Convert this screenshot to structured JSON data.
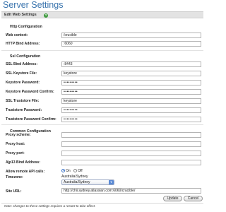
{
  "page_title": "Server Settings",
  "panel": {
    "title": "Edit Web Settings",
    "help_icon": "help-icon"
  },
  "http": {
    "title": "Http Configuration",
    "web_context_label": "Web context:",
    "web_context_value": "/crucible",
    "bind_address_label": "HTTP Bind Address:",
    "bind_address_value": ":6060"
  },
  "ssl": {
    "title": "Ssl Configuration",
    "bind_address_label": "SSL Bind Address:",
    "bind_address_value": ":8443",
    "keystore_file_label": "SSL Keystore File:",
    "keystore_file_value": "keystore",
    "keystore_password_label": "Keystore Password:",
    "keystore_password_value": "•••••••••",
    "keystore_password_confirm_label": "Keystore Password Confirm:",
    "keystore_password_confirm_value": "•••••••••",
    "truststore_file_label": "SSL Truststore File:",
    "truststore_file_value": "keystore",
    "truststore_password_label": "Truststore Password:",
    "truststore_password_value": "•••••••••",
    "truststore_password_confirm_label": "Truststore Password Confirm:",
    "truststore_password_confirm_value": "•••••••••"
  },
  "common": {
    "title": "Common Configuration",
    "proxy_scheme_label": "Proxy scheme:",
    "proxy_scheme_value": "",
    "proxy_host_label": "Proxy host:",
    "proxy_host_value": "",
    "proxy_port_label": "Proxy port:",
    "proxy_port_value": "",
    "ajp13_label": "Ajp13 Bind Address:",
    "ajp13_value": "",
    "remote_api_label": "Allow remote API calls:",
    "remote_api_on": "On",
    "remote_api_off": "Off",
    "remote_api_selected": "On",
    "timezone_label": "Timezone:",
    "timezone_text": "Australia/Sydney",
    "timezone_selected": "Australia/Sydney",
    "site_url_label": "Site URL:",
    "site_url_value": "http://chii.sydney.atlassian.com:6060/crucible/"
  },
  "buttons": {
    "update": "Update",
    "cancel": "Cancel"
  },
  "note": "Note: changes to these settings requires a restart to take effect.",
  "colors": {
    "title_blue": "#3873ad",
    "help_green": "#3d9a3d",
    "header_gray": "#e3e3e3"
  }
}
